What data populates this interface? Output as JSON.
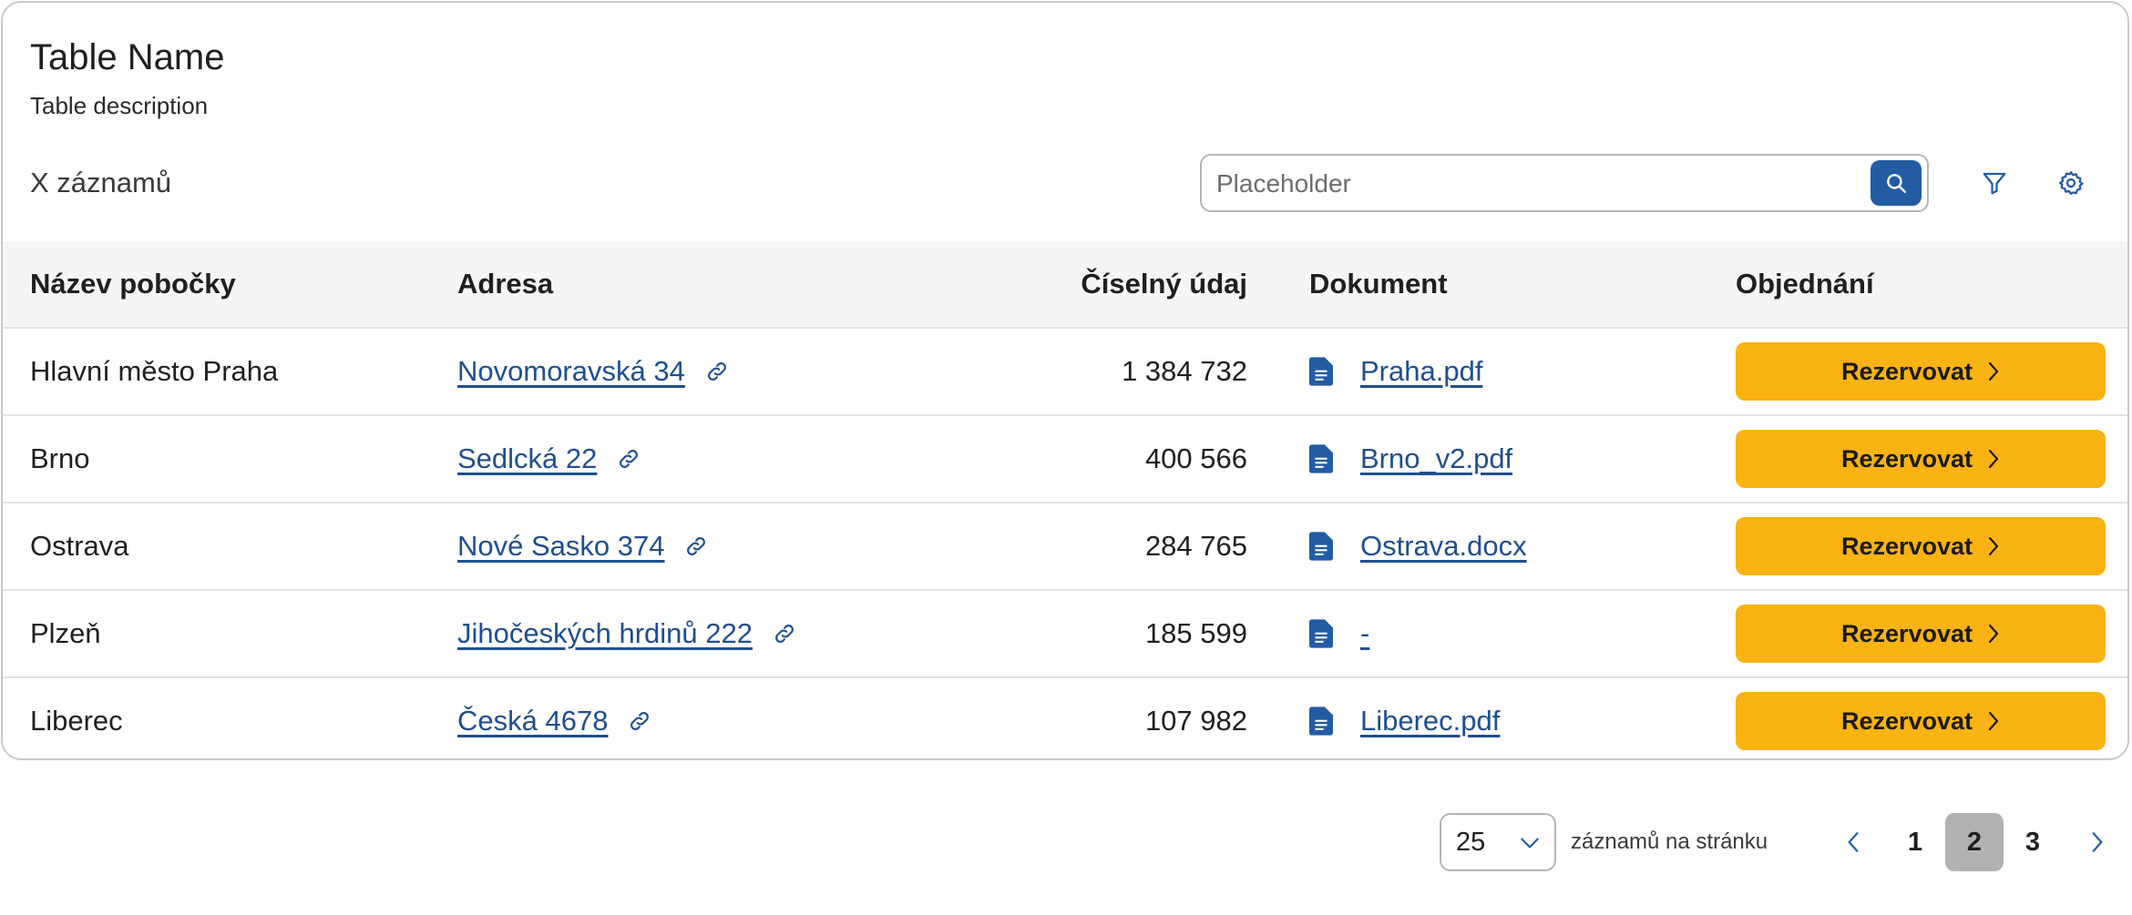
{
  "table": {
    "title": "Table Name",
    "description": "Table description",
    "record_count": "X záznamů"
  },
  "search": {
    "placeholder": "Placeholder",
    "value": ""
  },
  "icons": {
    "search": "search-icon",
    "filter": "filter-icon",
    "settings": "gear-icon",
    "link": "link-icon",
    "document": "document-icon",
    "chevron_right": "chevron-right-icon",
    "chevron_left": "chevron-left-icon",
    "chevron_down": "chevron-down-icon"
  },
  "columns": [
    "Název pobočky",
    "Adresa",
    "Číselný údaj",
    "Dokument",
    "Objednání"
  ],
  "rows": [
    {
      "name": "Hlavní město Praha",
      "address": "Novomoravská 34",
      "number": "1 384 732",
      "document": "Praha.pdf",
      "action": "Rezervovat"
    },
    {
      "name": "Brno",
      "address": "Sedlcká 22",
      "number": "400 566",
      "document": "Brno_v2.pdf",
      "action": "Rezervovat"
    },
    {
      "name": "Ostrava",
      "address": "Nové Sasko 374",
      "number": "284 765",
      "document": "Ostrava.docx",
      "action": "Rezervovat"
    },
    {
      "name": "Plzeň",
      "address": "Jihočeských hrdinů 222",
      "number": "185 599",
      "document": "-",
      "action": "Rezervovat"
    },
    {
      "name": "Liberec",
      "address": "Česká 4678",
      "number": "107 982",
      "document": "Liberec.pdf",
      "action": "Rezervovat"
    }
  ],
  "pagination": {
    "per_page": "25",
    "per_page_label": "záznamů na stránku",
    "pages": [
      "1",
      "2",
      "3"
    ],
    "current": "2"
  },
  "colors": {
    "accent_blue": "#235ca4",
    "link_blue": "#1e4f8f",
    "button_yellow": "#f9b312",
    "header_bg": "#f5f5f5",
    "active_page_bg": "#b2b2b2"
  }
}
